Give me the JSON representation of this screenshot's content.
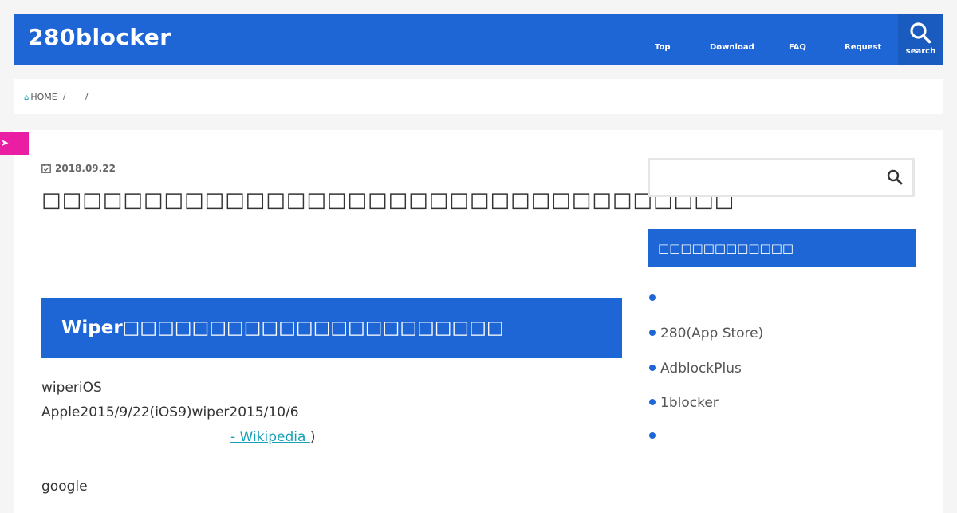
{
  "header": {
    "site_title": "280blocker",
    "nav": [
      "Top",
      "Download",
      "FAQ",
      "Request"
    ],
    "search_label": "search",
    "accent": "#1e66d6"
  },
  "breadcrumb": {
    "home": "HOME",
    "sep": "/"
  },
  "post": {
    "date": "2018.09.22",
    "title": "□□□□□□□□□□□□□□□□□□□□□□□□□□□□□□□□□□",
    "section_heading": "Wiper□□□□□□□□□□□□□□□□□□□□□□",
    "lines": [
      "wiperiOS",
      "Apple2015/9/22(iOS9)wiper2015/10/6"
    ],
    "wiki_link": " - Wikipedia ",
    "wiki_close": ")",
    "google": "google"
  },
  "sidebar": {
    "search_placeholder": "",
    "widget_title": "□□□□□□□□□□□□",
    "items": [
      "",
      "280(App Store)",
      "AdblockPlus",
      "1blocker",
      ""
    ]
  }
}
